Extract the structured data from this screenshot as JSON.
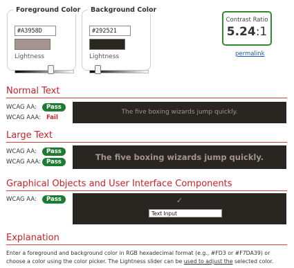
{
  "foreground": {
    "title": "Foreground Color",
    "hex": "#A3958D",
    "lightness_label": "Lightness",
    "lightness_fraction": 0.61,
    "swatch_color": "#A3958D"
  },
  "background": {
    "title": "Background Color",
    "hex": "#292521",
    "lightness_label": "Lightness",
    "lightness_fraction": 0.15,
    "swatch_color": "#292521"
  },
  "contrast": {
    "label": "Contrast Ratio",
    "value_main": "5.24",
    "value_suffix": ":1",
    "permalink": "permalink"
  },
  "sections": {
    "normal_title": "Normal Text",
    "large_title": "Large Text",
    "graphics_title": "Graphical Objects and User Interface Components",
    "explanation_title": "Explanation"
  },
  "normal": {
    "aa_label": "WCAG AA:",
    "aa_result": "Pass",
    "aaa_label": "WCAG AAA:",
    "aaa_result": "Fail",
    "sample": "The five boxing wizards jump quickly."
  },
  "large": {
    "aa_label": "WCAG AA:",
    "aa_result": "Pass",
    "aaa_label": "WCAG AAA:",
    "aaa_result": "Pass",
    "sample": "The five boxing wizards jump quickly."
  },
  "graphics": {
    "aa_label": "WCAG AA:",
    "aa_result": "Pass",
    "checkmark": "✓",
    "input_text": "Text Input"
  },
  "explanation": {
    "line1": "Enter a foreground and background color in RGB hexadecimal format (e.g., #FD3 or #F7DA39) or",
    "line2_a": "choose a color using the color picker. The Lightness slider can be ",
    "line2_link": "used to adjust the",
    "line2_b": " selected color."
  },
  "colors": {
    "pass": "#1e7b34",
    "fail": "#c7222a",
    "heading": "#c7222a",
    "ratio_border": "#2e8b2e",
    "preview_bg": "#292521",
    "preview_fg": "#A3958D"
  }
}
